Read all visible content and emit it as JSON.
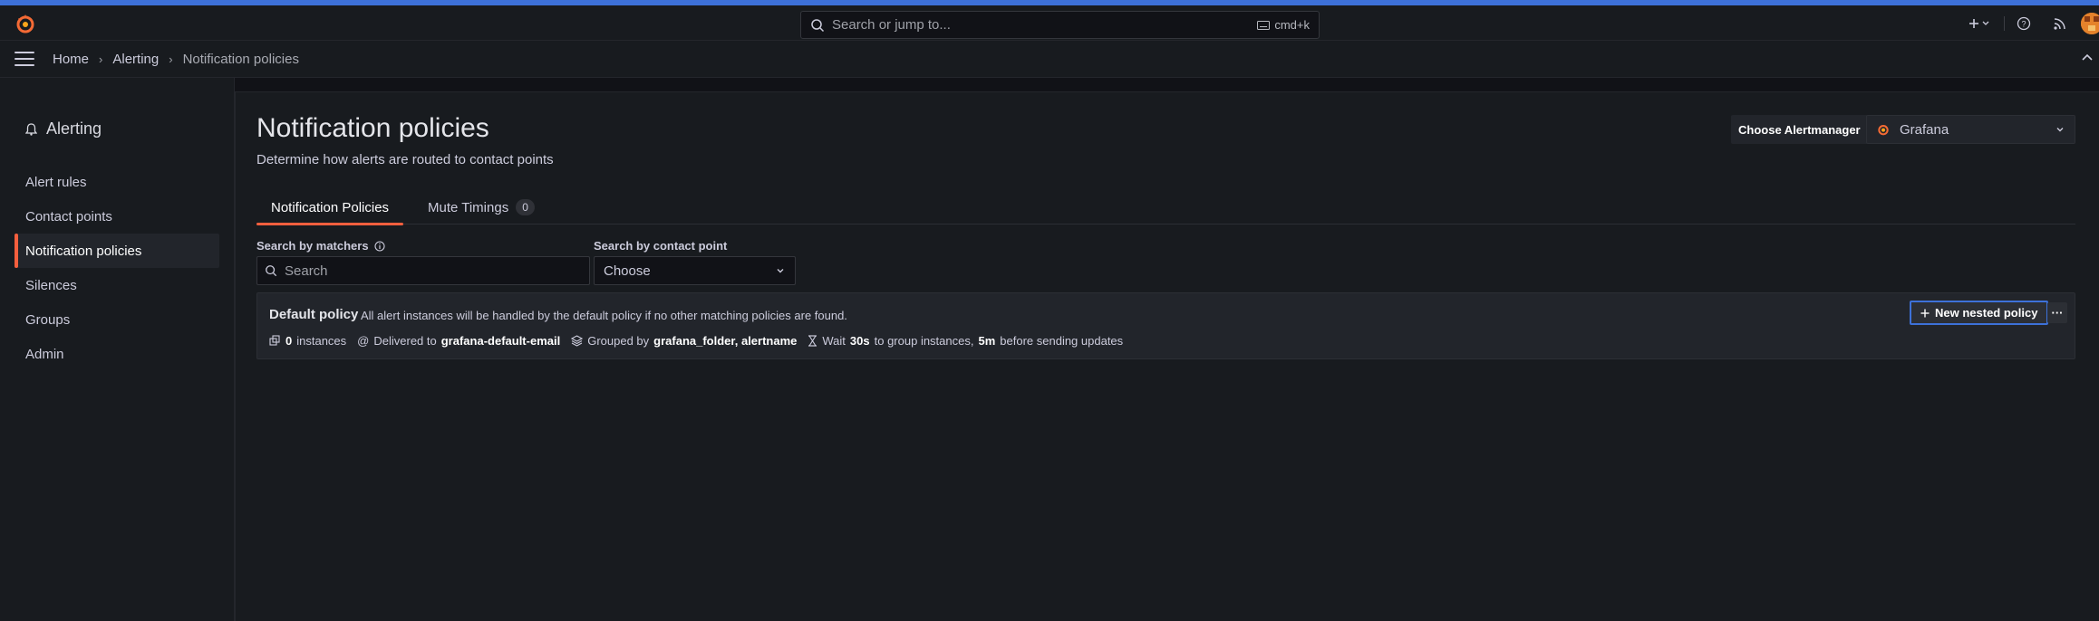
{
  "colors": {
    "accent": "#f55f3e",
    "topStripe": "#3d71d9",
    "focusBorder": "#3d71d9"
  },
  "search": {
    "placeholder": "Search or jump to...",
    "shortcut": "cmd+k"
  },
  "breadcrumb": [
    "Home",
    "Alerting",
    "Notification policies"
  ],
  "sidebar": {
    "title": "Alerting",
    "items": [
      {
        "label": "Alert rules",
        "active": false
      },
      {
        "label": "Contact points",
        "active": false
      },
      {
        "label": "Notification policies",
        "active": true
      },
      {
        "label": "Silences",
        "active": false
      },
      {
        "label": "Groups",
        "active": false
      },
      {
        "label": "Admin",
        "active": false
      }
    ]
  },
  "page": {
    "title": "Notification policies",
    "subtitle": "Determine how alerts are routed to contact points"
  },
  "alertmanager": {
    "label": "Choose Alertmanager",
    "value": "Grafana"
  },
  "tabs": [
    {
      "label": "Notification Policies",
      "active": true
    },
    {
      "label": "Mute Timings",
      "count": "0",
      "active": false
    }
  ],
  "filters": {
    "matchers_label": "Search by matchers",
    "matchers_placeholder": "Search",
    "contact_label": "Search by contact point",
    "contact_value": "Choose"
  },
  "policy": {
    "name": "Default policy",
    "description": "All alert instances will be handled by the default policy if no other matching policies are found.",
    "instances": "0",
    "instances_suffix": "instances",
    "delivered_prefix": "Delivered to",
    "contact_point": "grafana-default-email",
    "grouped_prefix": "Grouped by",
    "grouped_by": "grafana_folder, alertname",
    "wait_prefix": "Wait",
    "group_wait": "30s",
    "wait_mid": "to group instances,",
    "group_interval": "5m",
    "wait_suffix": "before sending updates",
    "new_nested_label": "New nested policy",
    "more_label": "···"
  }
}
